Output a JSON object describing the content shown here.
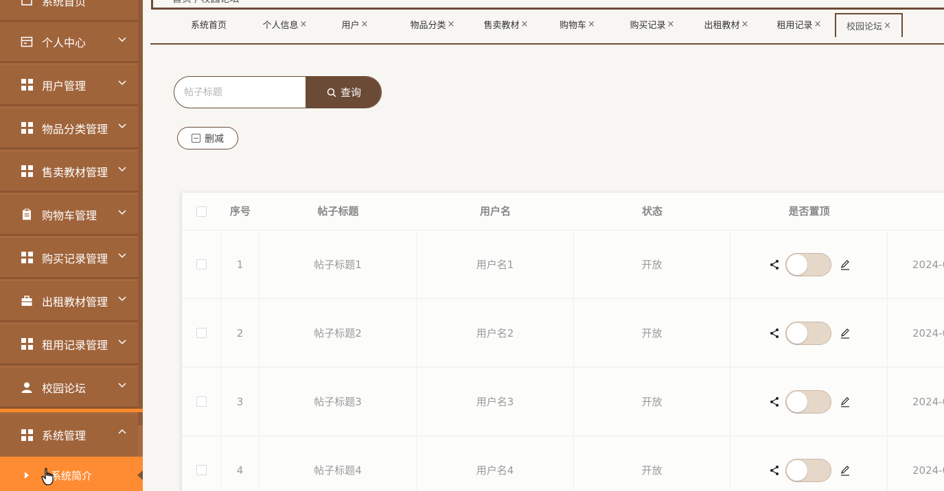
{
  "sidebar": {
    "top_partial": "系统首页",
    "items": [
      {
        "label": "个人中心",
        "icon": "calendar-icon"
      },
      {
        "label": "用户管理",
        "icon": "grid-icon"
      },
      {
        "label": "物品分类管理",
        "icon": "grid-icon"
      },
      {
        "label": "售卖教材管理",
        "icon": "grid-icon"
      },
      {
        "label": "购物车管理",
        "icon": "clipboard-icon"
      },
      {
        "label": "购买记录管理",
        "icon": "grid-icon"
      },
      {
        "label": "出租教材管理",
        "icon": "briefcase-icon"
      },
      {
        "label": "租用记录管理",
        "icon": "grid-icon"
      },
      {
        "label": "校园论坛",
        "icon": "user-icon"
      },
      {
        "label": "系统管理",
        "icon": "grid-icon",
        "expanded": true
      }
    ],
    "sub_item": "系统简介"
  },
  "header": {
    "breadcrumb": "首页 / 校园论坛"
  },
  "tabs": [
    {
      "label": "系统首页",
      "closable": false
    },
    {
      "label": "个人信息",
      "closable": true
    },
    {
      "label": "用户",
      "closable": true
    },
    {
      "label": "物品分类",
      "closable": true
    },
    {
      "label": "售卖教材",
      "closable": true
    },
    {
      "label": "购物车",
      "closable": true
    },
    {
      "label": "购买记录",
      "closable": true
    },
    {
      "label": "出租教材",
      "closable": true
    },
    {
      "label": "租用记录",
      "closable": true
    },
    {
      "label": "校园论坛",
      "closable": true,
      "active": true
    }
  ],
  "close_glyph": "×",
  "search": {
    "placeholder": "帖子标题",
    "value": "",
    "button_label": "查询"
  },
  "delete_button": "删减",
  "table": {
    "columns": [
      "序号",
      "帖子标题",
      "用户名",
      "状态",
      "是否置顶"
    ],
    "rows": [
      {
        "index": "1",
        "title": "帖子标题1",
        "user": "用户名1",
        "status": "开放",
        "pinned": false,
        "date": "2024-0"
      },
      {
        "index": "2",
        "title": "帖子标题2",
        "user": "用户名2",
        "status": "开放",
        "pinned": false,
        "date": "2024-0"
      },
      {
        "index": "3",
        "title": "帖子标题3",
        "user": "用户名3",
        "status": "开放",
        "pinned": false,
        "date": "2024-0"
      },
      {
        "index": "4",
        "title": "帖子标题4",
        "user": "用户名4",
        "status": "开放",
        "pinned": false,
        "date": "2024-0"
      }
    ]
  },
  "colors": {
    "sidebar_bg": "#a0643b",
    "accent_dark": "#6b4b35",
    "highlight_orange": "#ff8c33",
    "toggle_off": "#e6d8c9"
  }
}
